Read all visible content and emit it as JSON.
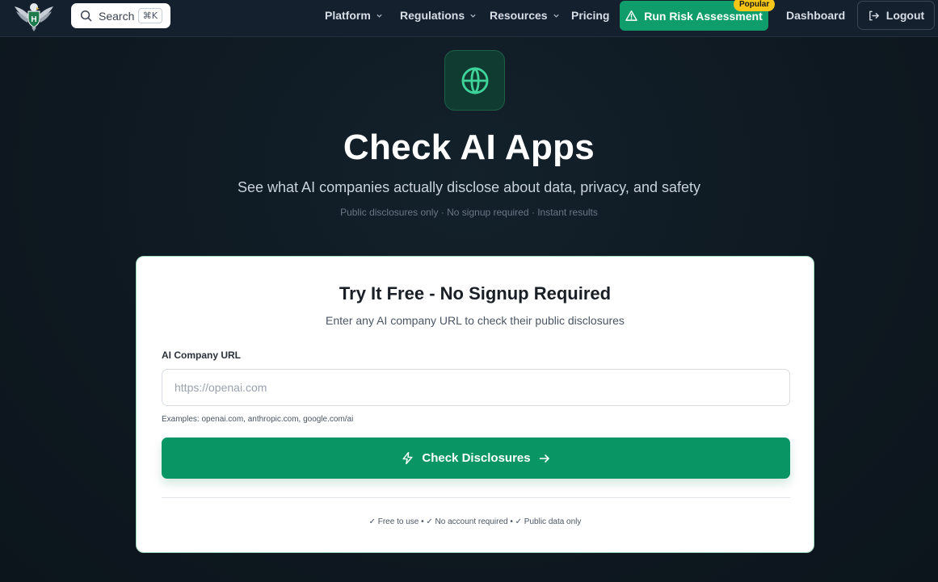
{
  "nav": {
    "search_label": "Search",
    "search_shortcut": "⌘K",
    "links": [
      {
        "label": "Platform"
      },
      {
        "label": "Regulations"
      },
      {
        "label": "Resources"
      },
      {
        "label": "Pricing"
      }
    ],
    "risk_button": "Run Risk Assessment",
    "popular_badge": "Popular",
    "dashboard": "Dashboard",
    "logout": "Logout"
  },
  "hero": {
    "title": "Check AI Apps",
    "subtitle": "See what AI companies actually disclose about data, privacy, and safety",
    "meta": "Public disclosures only · No signup required · Instant results"
  },
  "card": {
    "title": "Try It Free - No Signup Required",
    "subtitle": "Enter any AI company URL to check their public disclosures",
    "field_label": "AI Company URL",
    "input_value": "",
    "input_placeholder": "https://openai.com",
    "examples": "Examples: openai.com, anthropic.com, google.com/ai",
    "button_label": "Check Disclosures",
    "footer_note": "✓ Free to use • ✓ No account required • ✓ Public data only"
  },
  "colors": {
    "accent": "#0a9565",
    "badge": "#f5c518",
    "background": "#0f1923",
    "nav": "#14202e"
  },
  "icons": {
    "logo": "eagle-shield-logo",
    "search": "search-icon",
    "hero": "globe-icon",
    "risk": "warning-triangle-icon",
    "logout": "logout-icon",
    "button": "lightning-bolt-icon",
    "button_trailing": "arrow-right-icon"
  }
}
